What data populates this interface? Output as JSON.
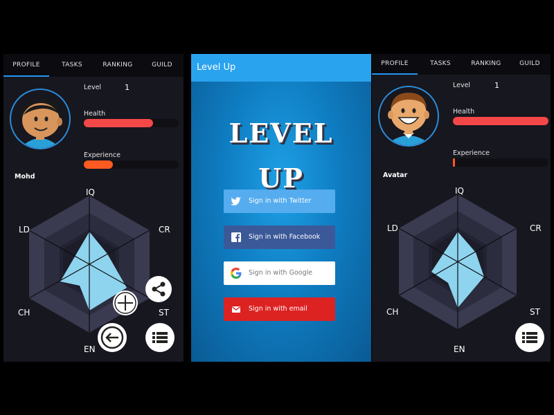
{
  "tabs": [
    "PROFILE",
    "TASKS",
    "RANKING",
    "GUILD"
  ],
  "stats_labels": {
    "level": "Level",
    "health": "Health",
    "experience": "Experience"
  },
  "radar_axes": [
    "IQ",
    "CR",
    "ST",
    "EN",
    "CH",
    "LD"
  ],
  "left_profile": {
    "level": "1",
    "health_fraction": 0.73,
    "experience_fraction": 0.31,
    "username": "Mohd"
  },
  "right_profile": {
    "level": "1",
    "health_fraction": 1.0,
    "experience_fraction": 0.02,
    "username": "Avatar"
  },
  "login": {
    "app_title": "Level Up",
    "logo_line1": "LEVEL",
    "logo_line2": "UP",
    "buttons": {
      "twitter": "Sign in with Twitter",
      "facebook": "Sign in with Facebook",
      "google": "Sign in with Google",
      "email": "Sign in with email"
    }
  },
  "colors": {
    "accent": "#2196f3",
    "health": "#f44848",
    "experience": "#ff5a22",
    "radar_fill": "#8ed4ee",
    "twitter": "#55acee",
    "facebook": "#3b5998",
    "email": "#dd2222"
  }
}
